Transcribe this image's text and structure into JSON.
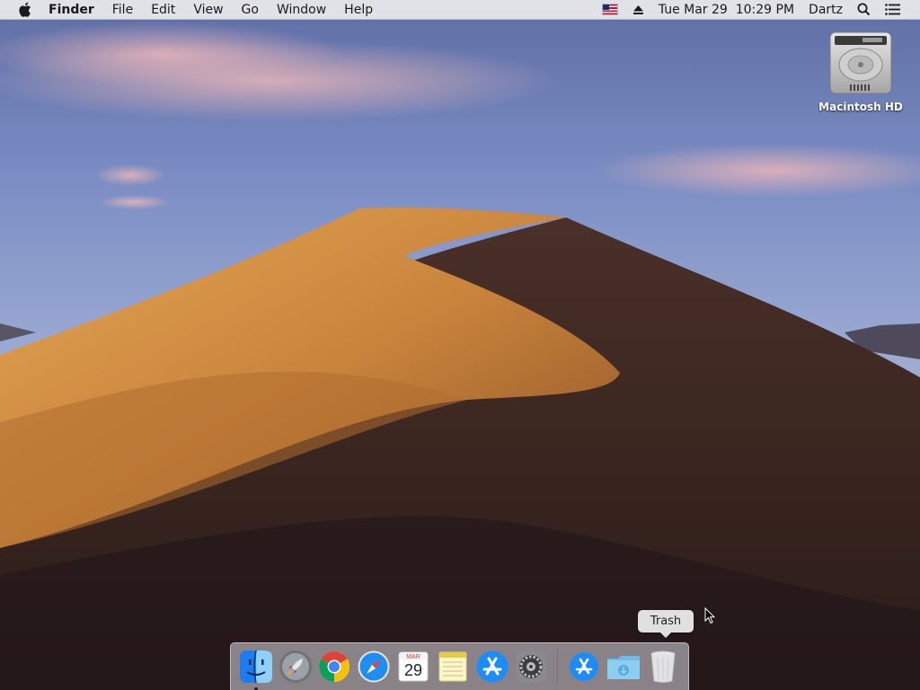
{
  "menubar": {
    "app_name": "Finder",
    "menus": [
      "File",
      "Edit",
      "View",
      "Go",
      "Window",
      "Help"
    ],
    "clock": "Tue Mar 29  10:29 PM",
    "user": "Dartz"
  },
  "desktop": {
    "items": [
      {
        "label": "Macintosh HD",
        "icon": "hard-drive-icon"
      }
    ]
  },
  "dock": {
    "tooltip": "Trash",
    "apps": [
      {
        "name": "finder",
        "icon": "finder-icon",
        "running": true
      },
      {
        "name": "launchpad",
        "icon": "rocket-icon",
        "running": false
      },
      {
        "name": "chrome",
        "icon": "chrome-icon",
        "running": false
      },
      {
        "name": "safari",
        "icon": "compass-icon",
        "running": false
      },
      {
        "name": "calendar",
        "icon": "calendar-icon",
        "running": false
      },
      {
        "name": "notes",
        "icon": "notes-icon",
        "running": false
      },
      {
        "name": "app-store",
        "icon": "app-store-icon",
        "running": false
      },
      {
        "name": "system-preferences",
        "icon": "gear-icon",
        "running": false
      }
    ],
    "right_items": [
      {
        "name": "applications",
        "icon": "app-store-icon"
      },
      {
        "name": "downloads",
        "icon": "folder-download-icon"
      },
      {
        "name": "trash",
        "icon": "trash-icon"
      }
    ],
    "calendar": {
      "month": "MAR",
      "day": "29"
    }
  },
  "colors": {
    "accent": "#1e7cf0",
    "menubar": "#ececee"
  }
}
